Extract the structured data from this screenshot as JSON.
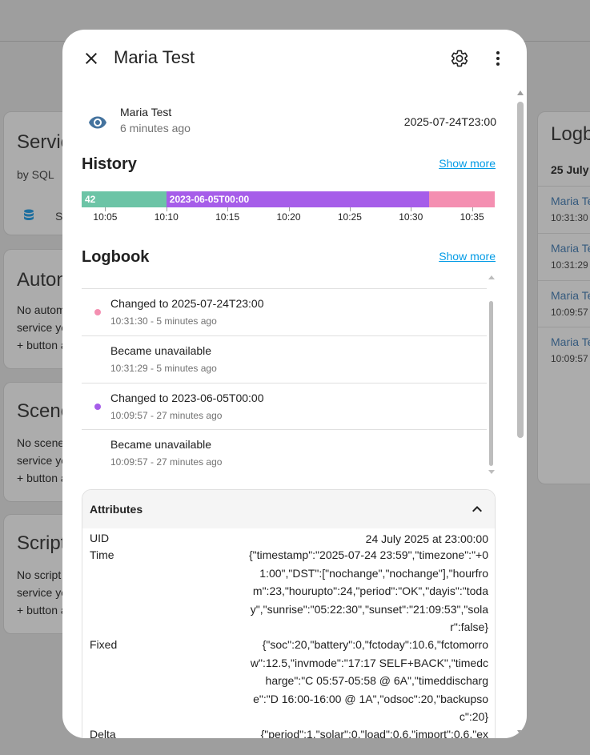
{
  "background": {
    "cards": [
      {
        "title": "Servic",
        "subtitle": "by SQL",
        "item": "S"
      },
      {
        "title": "Auton",
        "lines": [
          "No autom",
          "service ye",
          "+ button a"
        ]
      },
      {
        "title": "Scene",
        "lines": [
          "No scene",
          "service ye",
          "+ button a"
        ]
      },
      {
        "title": "Script",
        "lines": [
          "No script",
          "service ye",
          "+ button a"
        ]
      }
    ],
    "logbook_card": {
      "title": "Logb",
      "date": "25 July",
      "entries": [
        {
          "name": "Maria Te",
          "time": "10:31:30"
        },
        {
          "name": "Maria Te",
          "time": "10:31:29"
        },
        {
          "name": "Maria Te",
          "time": "10:09:57"
        },
        {
          "name": "Maria Te",
          "time": "10:09:57"
        }
      ]
    }
  },
  "dialog": {
    "title": "Maria Test",
    "close_icon": "close-icon",
    "settings_icon": "gear-icon",
    "more_icon": "more-vertical-icon",
    "state": {
      "icon": "eye-icon",
      "name": "Maria Test",
      "last_changed": "6 minutes ago",
      "value": "2025-07-24T23:00"
    },
    "history": {
      "title": "History",
      "show_more": "Show more",
      "segments": [
        {
          "label": "42",
          "color": "#6cc4a6",
          "start": 0.0,
          "end": 0.205
        },
        {
          "label": "2023-06-05T00:00",
          "color": "#a65de9",
          "start": 0.205,
          "end": 0.842
        },
        {
          "label": "",
          "color": "#f48fb1",
          "start": 0.842,
          "end": 1.0
        }
      ],
      "ticks": [
        {
          "label": "10:05",
          "pos": 0.057
        },
        {
          "label": "10:10",
          "pos": 0.205
        },
        {
          "label": "10:15",
          "pos": 0.353
        },
        {
          "label": "10:20",
          "pos": 0.501
        },
        {
          "label": "10:25",
          "pos": 0.649
        },
        {
          "label": "10:30",
          "pos": 0.797
        },
        {
          "label": "10:35",
          "pos": 0.945
        }
      ]
    },
    "logbook": {
      "title": "Logbook",
      "show_more": "Show more",
      "entries": [
        {
          "message": "Changed to 2025-07-24T23:00",
          "time": "10:31:30 - 5 minutes ago",
          "dot_color": "#f48fb1"
        },
        {
          "message": "Became unavailable",
          "time": "10:31:29 - 5 minutes ago",
          "dot_color": ""
        },
        {
          "message": "Changed to 2023-06-05T00:00",
          "time": "10:09:57 - 27 minutes ago",
          "dot_color": "#a65de9"
        },
        {
          "message": "Became unavailable",
          "time": "10:09:57 - 27 minutes ago",
          "dot_color": ""
        }
      ]
    },
    "attributes": {
      "title": "Attributes",
      "collapse_icon": "chevron-up-icon",
      "rows": [
        {
          "key": "UID",
          "value": "24 July 2025 at 23:00:00"
        },
        {
          "key": "Time",
          "value": "{\"timestamp\":\"2025-07-24 23:59\",\"timezone\":\"+01:00\",\"DST\":[\"nochange\",\"nochange\"],\"hourfrom\":23,\"hourupto\":24,\"period\":\"OK\",\"dayis\":\"today\",\"sunrise\":\"05:22:30\",\"sunset\":\"21:09:53\",\"solar\":false}"
        },
        {
          "key": "Fixed",
          "value": "{\"soc\":20,\"battery\":0,\"fctoday\":10.6,\"fctomorrow\":12.5,\"invmode\":\"17:17 SELF+BACK\",\"timedcharge\":\"C 05:57-05:58 @ 6A\",\"timeddischarge\":\"D 16:00-16:00 @ 1A\",\"odsoc\":20,\"backupsoc\":20}"
        },
        {
          "key": "Delta",
          "value": "{\"period\":1,\"solar\":0,\"load\":0.6,\"import\":0.6,\"ex"
        }
      ]
    }
  }
}
